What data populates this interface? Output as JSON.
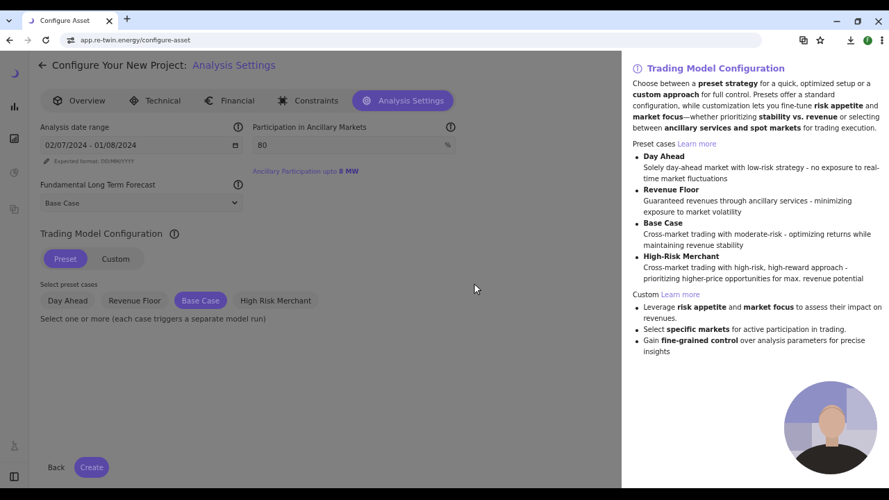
{
  "browser": {
    "tab_title": "Configure Asset",
    "url": "app.re-twin.energy/configure-asset",
    "profile_initial": "F"
  },
  "page": {
    "title": "Configure Your New Project:",
    "section": "Analysis Settings"
  },
  "tabs": [
    {
      "label": "Overview",
      "kind": "cube",
      "selected": false
    },
    {
      "label": "Technical",
      "kind": "diamond",
      "selected": false
    },
    {
      "label": "Financial",
      "kind": "euro",
      "selected": false
    },
    {
      "label": "Constraints",
      "kind": "chip",
      "selected": false
    },
    {
      "label": "Analysis Settings",
      "kind": "gear",
      "selected": true
    }
  ],
  "date_range": {
    "label": "Analysis date range",
    "value": "02/07/2024 - 01/08/2024",
    "hint": "Expected format:  DD/MM/YYYY"
  },
  "participation": {
    "label": "Participation in Ancillary Markets",
    "value": "80",
    "unit": "%",
    "note": "Ancillary Participation upto **8 MW**"
  },
  "forecast": {
    "label": "Fundamental Long Term Forecast",
    "value": "Base Case"
  },
  "trading": {
    "title": "Trading Model Configuration",
    "modes": [
      {
        "label": "Preset",
        "selected": true
      },
      {
        "label": "Custom",
        "selected": false
      }
    ],
    "presets_label": "Select preset cases",
    "presets": [
      {
        "label": "Day Ahead",
        "selected": false
      },
      {
        "label": "Revenue Floor",
        "selected": false
      },
      {
        "label": "Base Case",
        "selected": true
      },
      {
        "label": "High Risk Merchant",
        "selected": false
      }
    ],
    "help": "Select one or more (each case triggers a separate model run)"
  },
  "footer": {
    "back": "Back",
    "create": "Create"
  },
  "panel": {
    "title": "Trading Model Configuration",
    "intro": "Choose between a **preset strategy** for a quick, optimized setup or a **custom approach** for full control. Presets offer a standard configuration, while customization lets you fine-tune **risk appetite** and **market focus**—whether prioritizing **stability vs. revenue** or selecting between **ancillary services and spot markets** for trading execution.",
    "sections": [
      {
        "heading": "Preset cases",
        "link": "Learn more",
        "items": [
          {
            "title": "Day Ahead",
            "text": "Solely day-ahead market with low-risk strategy - no exposure to real-time market fluctuations"
          },
          {
            "title": "Revenue Floor",
            "text": "Guaranteed revenues through ancillary services - minimizing exposure to market volatility"
          },
          {
            "title": "Base Case",
            "text": "Cross-market trading with moderate-risk - optimizing returns while maintaining revenue stability"
          },
          {
            "title": "High-Risk Merchant",
            "text": "Cross-market trading with high-risk, high-reward approach - prioritizing higher-price opportunities for max. revenue potential"
          }
        ]
      },
      {
        "heading": "Custom",
        "link": "Learn more",
        "items": [
          {
            "text": "Leverage **risk appetite** and **market focus** to assess their impact on revenues."
          },
          {
            "text": "Select **specific markets** for active participation in trading."
          },
          {
            "text": "Gain **fine-grained control** over analysis parameters for precise insights"
          }
        ]
      }
    ]
  }
}
